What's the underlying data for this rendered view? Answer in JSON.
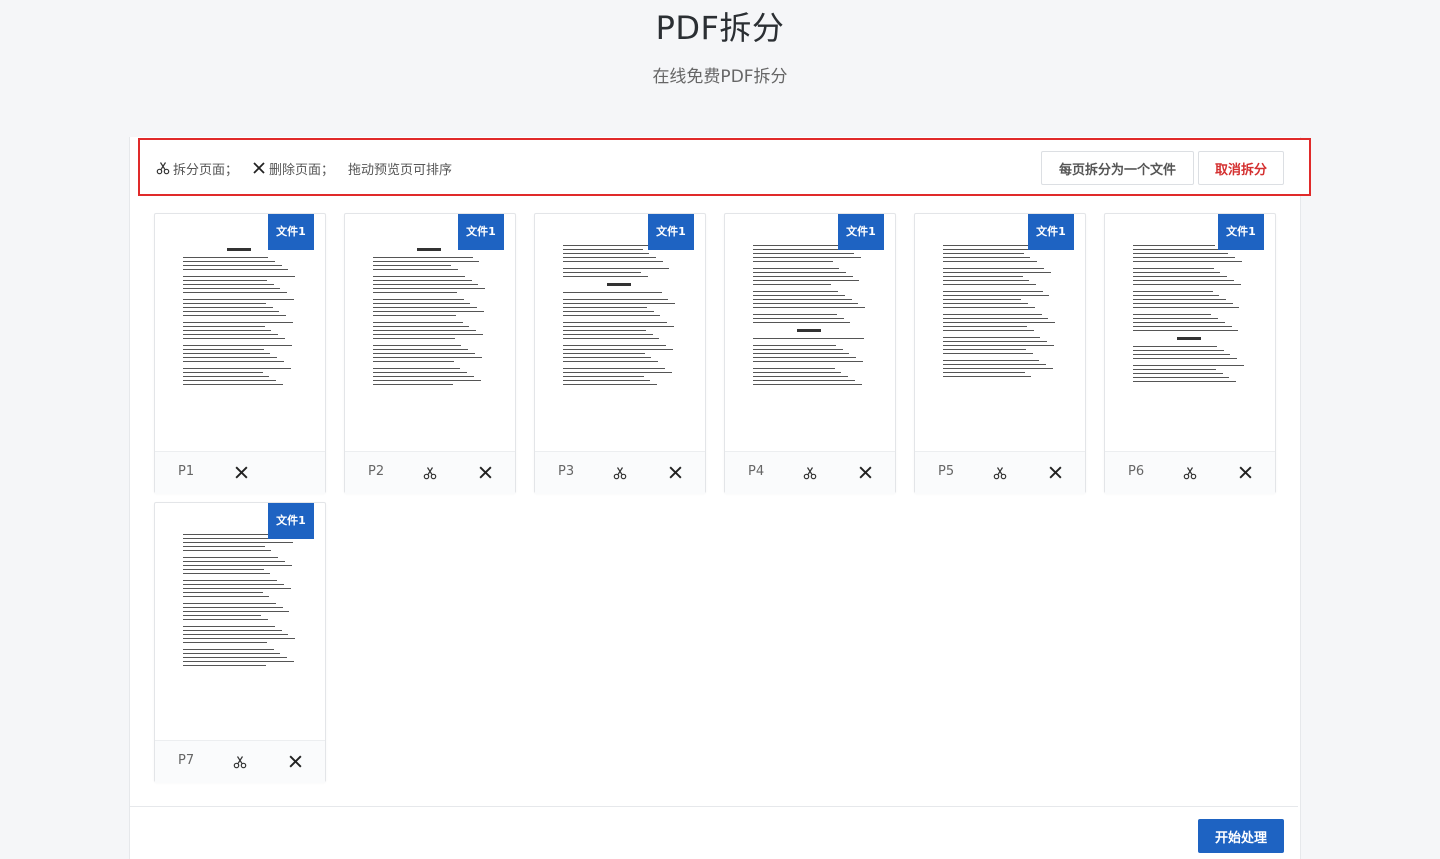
{
  "header": {
    "title": "PDF拆分",
    "subtitle": "在线免费PDF拆分"
  },
  "toolbar": {
    "hint_split": "拆分页面；",
    "hint_delete": "删除页面；",
    "hint_drag": "拖动预览页可排序",
    "split_each_label": "每页拆分为一个文件",
    "cancel_label": "取消拆分"
  },
  "pages": [
    {
      "label": "P1",
      "badge": "文件1",
      "has_split": false
    },
    {
      "label": "P2",
      "badge": "文件1",
      "has_split": true
    },
    {
      "label": "P3",
      "badge": "文件1",
      "has_split": true
    },
    {
      "label": "P4",
      "badge": "文件1",
      "has_split": true
    },
    {
      "label": "P5",
      "badge": "文件1",
      "has_split": true
    },
    {
      "label": "P6",
      "badge": "文件1",
      "has_split": true
    },
    {
      "label": "P7",
      "badge": "文件1",
      "has_split": true
    }
  ],
  "footer": {
    "start_label": "开始处理"
  },
  "colors": {
    "accent": "#1e63c2",
    "highlight_border": "#e02a2a",
    "cancel_text": "#d43030"
  }
}
